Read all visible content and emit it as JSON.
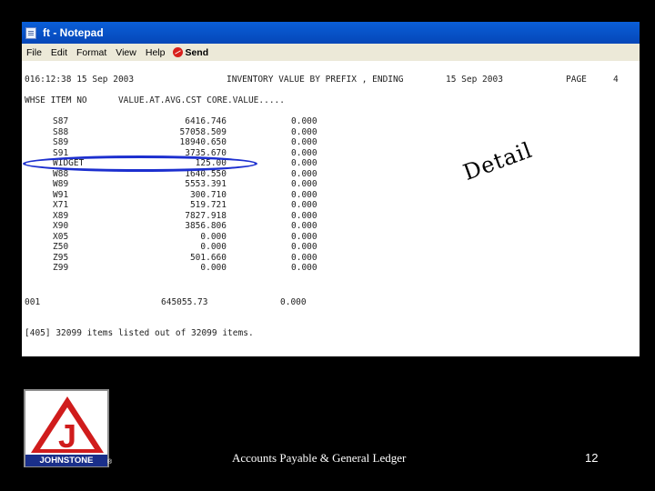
{
  "window": {
    "title": "ft - Notepad"
  },
  "menu": [
    "File",
    "Edit",
    "Format",
    "View",
    "Help"
  ],
  "send_label": "Send",
  "report": {
    "header": {
      "time_date": "016:12:38 15 Sep 2003",
      "title": "INVENTORY VALUE BY PREFIX , ENDING",
      "ending_date": "15 Sep 2003",
      "page_label": "PAGE",
      "page_number": "4"
    },
    "columns": "WHSE ITEM NO      VALUE.AT.AVG.CST CORE.VALUE.....",
    "rows": [
      {
        "item": "S87",
        "value": "6416.746",
        "core": "0.000"
      },
      {
        "item": "S88",
        "value": "57058.509",
        "core": "0.000"
      },
      {
        "item": "S89",
        "value": "18940.650",
        "core": "0.000"
      },
      {
        "item": "S91",
        "value": "3735.670",
        "core": "0.000"
      },
      {
        "item": "WIDGET",
        "value": "125.00",
        "core": "0.000"
      },
      {
        "item": "W88",
        "value": "1640.550",
        "core": "0.000"
      },
      {
        "item": "W89",
        "value": "5553.391",
        "core": "0.000"
      },
      {
        "item": "W91",
        "value": "300.710",
        "core": "0.000"
      },
      {
        "item": "X71",
        "value": "519.721",
        "core": "0.000"
      },
      {
        "item": "X89",
        "value": "7827.918",
        "core": "0.000"
      },
      {
        "item": "X90",
        "value": "3856.806",
        "core": "0.000"
      },
      {
        "item": "X05",
        "value": "0.000",
        "core": "0.000"
      },
      {
        "item": "Z50",
        "value": "0.000",
        "core": "0.000"
      },
      {
        "item": "Z95",
        "value": "501.660",
        "core": "0.000"
      },
      {
        "item": "Z99",
        "value": "0.000",
        "core": "0.000"
      }
    ],
    "total": {
      "whse": "001",
      "value": "645055.73",
      "core": "0.000"
    },
    "summary": "[405] 32099 items listed out of 32099 items."
  },
  "annotation": "Detail",
  "logo": {
    "text": "JOHNSTONE",
    "letter": "J",
    "reg": "®"
  },
  "footer": {
    "caption": "Accounts Payable & General Ledger",
    "page": "12"
  },
  "colors": {
    "titlebar": "#0547b8",
    "highlight_ring": "#1c2fcf",
    "logo_red": "#d01c1c",
    "logo_blue": "#1a2f8a"
  }
}
